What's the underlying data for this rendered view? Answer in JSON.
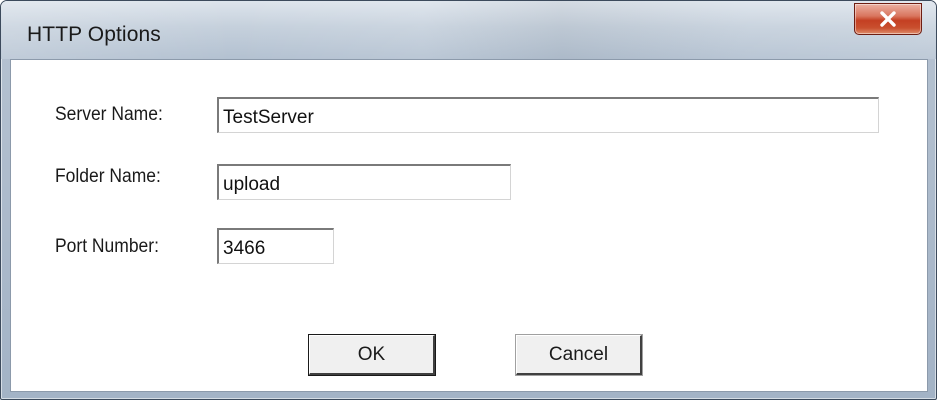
{
  "window": {
    "title": "HTTP Options"
  },
  "form": {
    "server_name": {
      "label": "Server Name:",
      "value": "TestServer"
    },
    "folder_name": {
      "label": "Folder Name:",
      "value": "upload"
    },
    "port_number": {
      "label": "Port Number:",
      "value": "3466"
    }
  },
  "buttons": {
    "ok_label": "OK",
    "cancel_label": "Cancel"
  },
  "icons": {
    "close": "close-icon"
  },
  "colors": {
    "close_button": "#c9502f",
    "title_bar": "#c5d0dc",
    "client_background": "#ffffff"
  }
}
